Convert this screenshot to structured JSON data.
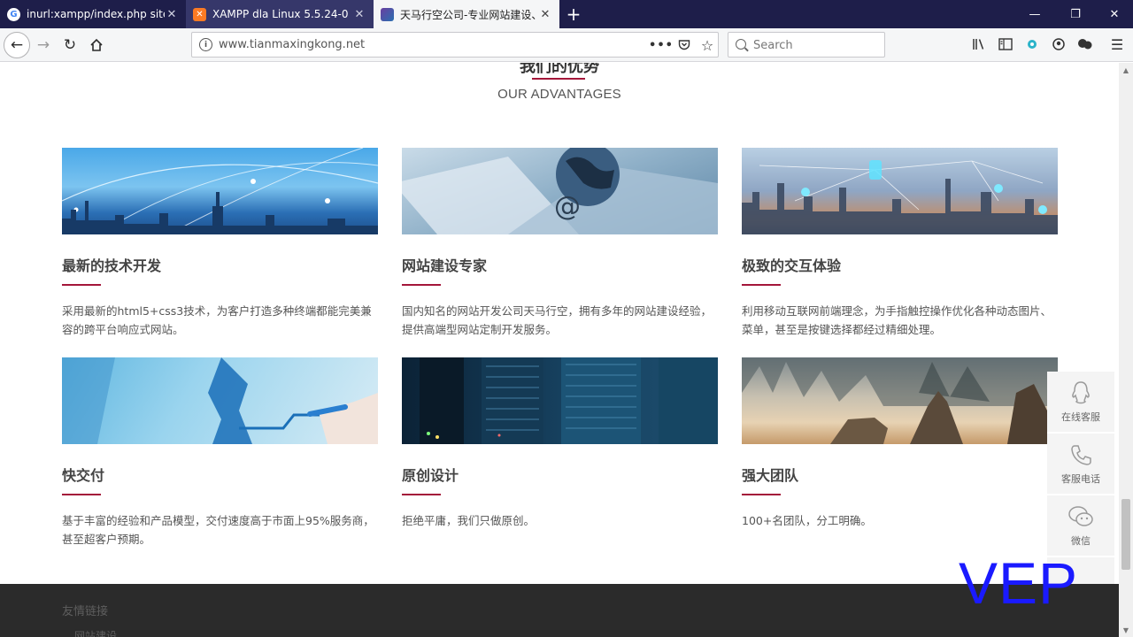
{
  "browser": {
    "tabs": [
      {
        "title": "inurl:xampp/index.php site:.net",
        "favicon": "google-icon"
      },
      {
        "title": "XAMPP dla Linux 5.5.24-0",
        "favicon": "xampp-icon"
      },
      {
        "title": "天马行空公司-专业网站建设、",
        "favicon": "site-icon"
      }
    ],
    "url": "www.tianmaxingkong.net",
    "search_placeholder": "Search"
  },
  "section": {
    "title": "我们的优势",
    "subtitle": "OUR ADVANTAGES"
  },
  "cards": [
    {
      "title": "最新的技术开发",
      "desc": "采用最新的html5+css3技术，为客户打造多种终端都能完美兼容的跨平台响应式网站。",
      "image": "city-network-image"
    },
    {
      "title": "网站建设专家",
      "desc": "国内知名的网站开发公司天马行空，拥有多年的网站建设经验，提供高端型网站定制开发服务。",
      "image": "keyboard-globe-image"
    },
    {
      "title": "极致的交互体验",
      "desc": "利用移动互联网前端理念，为手指触控操作优化各种动态图片、菜单，甚至是按键选择都经过精细处理。",
      "image": "city-icons-image"
    },
    {
      "title": "快交付",
      "desc": "基于丰富的经验和产品模型，交付速度高于市面上95%服务商，甚至超客户预期。",
      "image": "hand-chart-image"
    },
    {
      "title": "原创设计",
      "desc": "拒绝平庸，我们只做原创。",
      "image": "server-image"
    },
    {
      "title": "强大团队",
      "desc": "100+名团队，分工明确。",
      "image": "wolves-image"
    }
  ],
  "side_widget": [
    {
      "label": "在线客服",
      "icon": "qq-icon"
    },
    {
      "label": "客服电话",
      "icon": "phone-icon"
    },
    {
      "label": "微信",
      "icon": "wechat-icon"
    }
  ],
  "footer": {
    "title": "友情链接",
    "link": "网站建设"
  },
  "watermark": "VEP",
  "colors": {
    "accent": "#a4163a",
    "tabbar": "#1e1e4a",
    "footer": "#2b2b2b"
  }
}
